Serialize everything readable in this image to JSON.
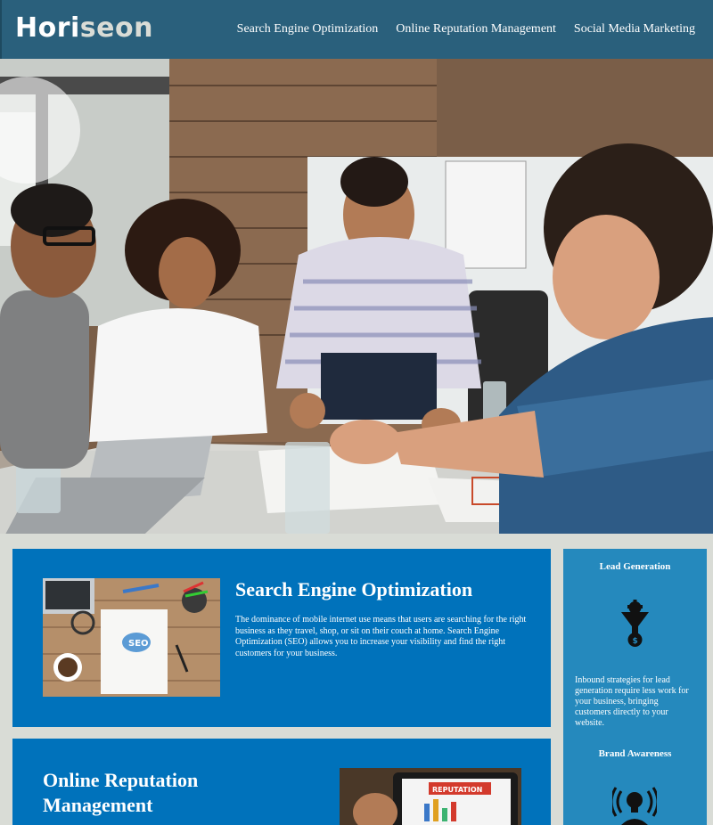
{
  "header": {
    "logo_part1": "Hori",
    "logo_part2": "seon",
    "nav": [
      {
        "label": "Search Engine Optimization"
      },
      {
        "label": "Online Reputation Management"
      },
      {
        "label": "Social Media Marketing"
      }
    ]
  },
  "hero": {
    "image": "team-meeting-photo"
  },
  "cards": [
    {
      "title": "Search Engine Optimization",
      "image": "seo-notebook-image",
      "image_text": "SEO",
      "text": "The dominance of mobile internet use means that users are searching for the right business as they travel, shop, or sit on their couch at home. Search Engine Optimization (SEO) allows you to increase your visibility and find the right customers for your business."
    },
    {
      "title_line1": "Online Reputation",
      "title_line2": "Management",
      "image": "reputation-tablet-image",
      "image_text": "REPUTATION"
    }
  ],
  "sidebar": {
    "items": [
      {
        "title": "Lead Generation",
        "icon": "funnel-gear-icon",
        "text": "Inbound strategies for lead generation require less work for your business, bringing customers directly to your website."
      },
      {
        "title": "Brand Awareness",
        "icon": "lightbulb-broadcast-icon"
      }
    ]
  },
  "colors": {
    "header_bg": "#2a607c",
    "card_bg": "#0072bb",
    "sidebar_bg": "#2589bd",
    "page_bg": "#d9dcd6"
  }
}
